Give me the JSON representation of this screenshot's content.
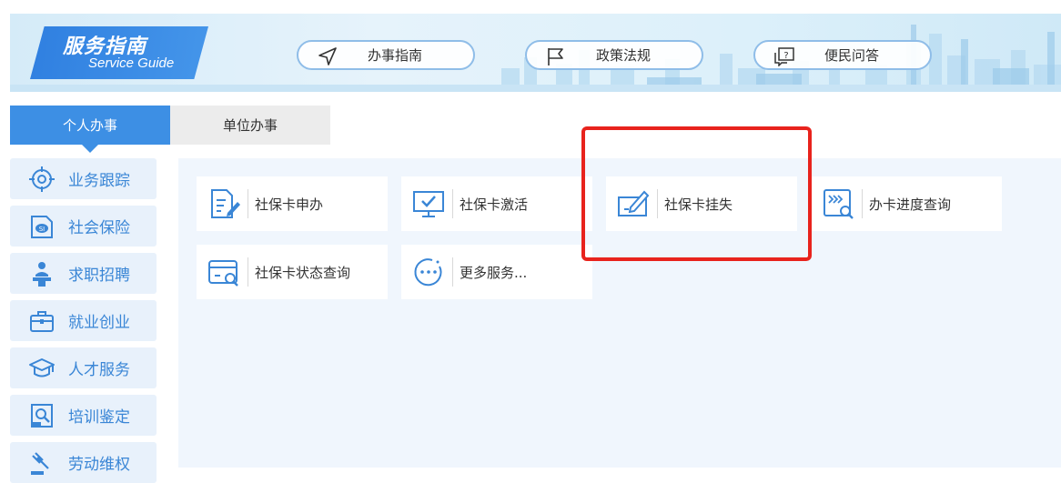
{
  "banner": {
    "title_cn": "服务指南",
    "title_en": "Service Guide",
    "pills": [
      {
        "label": "办事指南",
        "icon": "navigation-arrow-icon"
      },
      {
        "label": "政策法规",
        "icon": "flag-icon"
      },
      {
        "label": "便民问答",
        "icon": "question-chat-icon"
      }
    ]
  },
  "tabs": [
    {
      "label": "个人办事",
      "active": true
    },
    {
      "label": "单位办事",
      "active": false
    }
  ],
  "sidebar": {
    "items": [
      {
        "label": "业务跟踪",
        "icon": "target-icon"
      },
      {
        "label": "社会保险",
        "icon": "social-insurance-icon"
      },
      {
        "label": "求职招聘",
        "icon": "speaker-icon"
      },
      {
        "label": "就业创业",
        "icon": "briefcase-icon"
      },
      {
        "label": "人才服务",
        "icon": "graduation-cap-icon"
      },
      {
        "label": "培训鉴定",
        "icon": "search-document-icon"
      },
      {
        "label": "劳动维权",
        "icon": "gavel-icon"
      }
    ]
  },
  "services": {
    "cards": [
      {
        "label": "社保卡申办",
        "icon": "edit-document-icon"
      },
      {
        "label": "社保卡激活",
        "icon": "monitor-check-icon"
      },
      {
        "label": "社保卡挂失",
        "icon": "pen-card-icon"
      },
      {
        "label": "办卡进度查询",
        "icon": "progress-search-icon"
      },
      {
        "label": "社保卡状态查询",
        "icon": "card-search-icon"
      },
      {
        "label": "更多服务...",
        "icon": "more-dots-icon"
      }
    ]
  },
  "colors": {
    "accent": "#3d8fe4",
    "icon_blue": "#3a86d6",
    "highlight_red": "#e8231d"
  }
}
